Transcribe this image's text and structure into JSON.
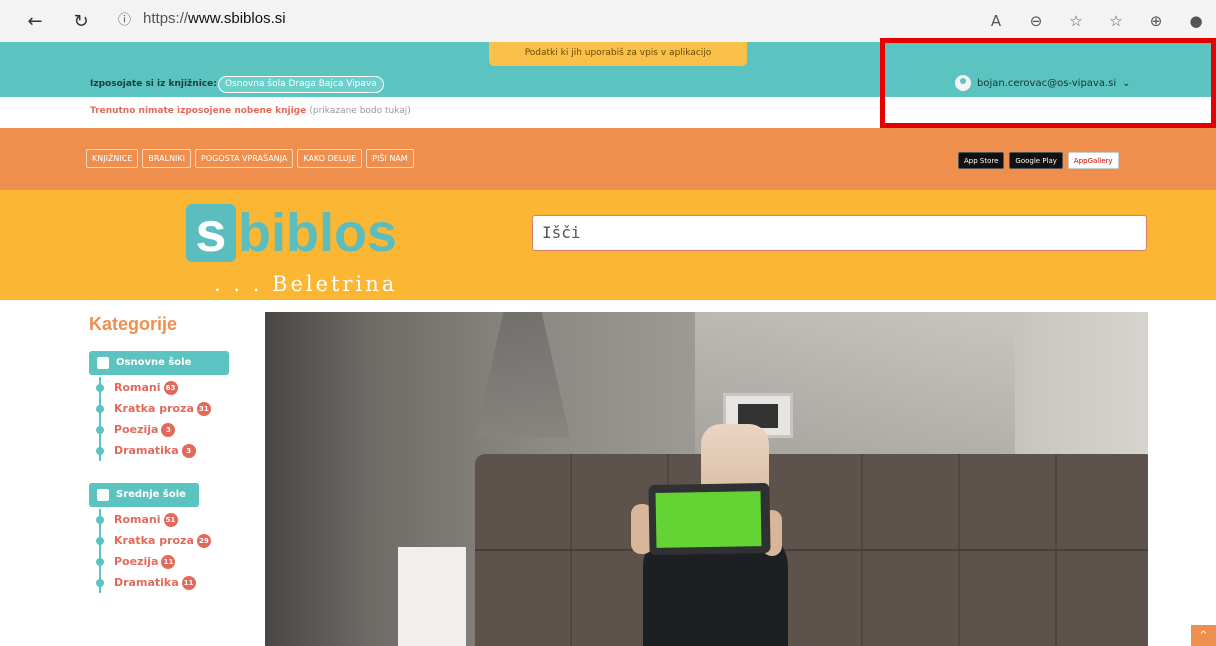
{
  "browser": {
    "back_icon": "arrow-left-icon",
    "reload_icon": "reload-icon",
    "url_prefix": "https://",
    "url_domain": "www.sbiblos.si"
  },
  "topbar": {
    "tooltip": "Podatki ki jih uporabiš za vpis v aplikacijo",
    "borrow_label": "Izposojate si iz knjižnice:",
    "library": "Osnovna šola Draga Bajca Vipava",
    "user_email": "bojan.cerovac@os-vipava.si",
    "user_chevron": "⌄"
  },
  "info": {
    "message": "Trenutno nimate izposojene nobene knjige",
    "hint": "(prikazane bodo tukaj)"
  },
  "nav": {
    "links": [
      "KNJIŽNICE",
      "BRALNIKI",
      "POGOSTA VPRAŠANJA",
      "KAKO DELUJE",
      "PIŠI NAM"
    ],
    "stores": [
      "App Store",
      "Google Play",
      "AppGallery"
    ]
  },
  "header": {
    "logo_s": "s",
    "logo_rest": "biblos",
    "tagline": ". . . Beletrina",
    "search_placeholder": "Išči"
  },
  "sidebar": {
    "title": "Kategorije",
    "groups": [
      {
        "label": "Osnovne šole",
        "items": [
          {
            "label": "Romani",
            "count": "63"
          },
          {
            "label": "Kratka proza",
            "count": "31"
          },
          {
            "label": "Poezija",
            "count": "3"
          },
          {
            "label": "Dramatika",
            "count": "3"
          }
        ]
      },
      {
        "label": "Srednje šole",
        "items": [
          {
            "label": "Romani",
            "count": "51"
          },
          {
            "label": "Kratka proza",
            "count": "29"
          },
          {
            "label": "Poezija",
            "count": "11"
          },
          {
            "label": "Dramatika",
            "count": "11"
          }
        ]
      }
    ]
  },
  "colors": {
    "teal": "#5bc3c0",
    "orange": "#ee8f4e",
    "yellow": "#fbb733",
    "highlight": "#e60000"
  }
}
